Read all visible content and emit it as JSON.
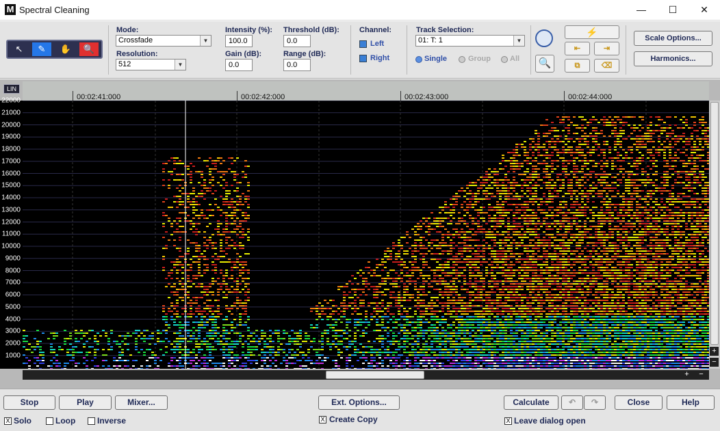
{
  "window": {
    "title": "Spectral Cleaning",
    "app_icon": "M",
    "minimize": "—",
    "maximize": "☐",
    "close": "✕"
  },
  "tools": [
    {
      "icon": "pointer-icon",
      "glyph": "↖"
    },
    {
      "icon": "pencil-icon",
      "glyph": "✎"
    },
    {
      "icon": "hand-icon",
      "glyph": "✋"
    },
    {
      "icon": "zoom-icon",
      "glyph": "🔍"
    }
  ],
  "params": {
    "mode_label": "Mode:",
    "mode_value": "Crossfade",
    "resolution_label": "Resolution:",
    "resolution_value": "512",
    "intensity_label": "Intensity (%):",
    "intensity_value": "100.0",
    "gain_label": "Gain (dB):",
    "gain_value": "0.0",
    "threshold_label": "Threshold (dB):",
    "threshold_value": "0.0",
    "range_label": "Range (dB):",
    "range_value": "0.0"
  },
  "channel": {
    "label": "Channel:",
    "left": "Left",
    "right": "Right"
  },
  "track": {
    "label": "Track Selection:",
    "value": "01: T:  1",
    "single": "Single",
    "group": "Group",
    "all": "All"
  },
  "side_buttons": {
    "scale_options": "Scale Options...",
    "harmonics": "Harmonics..."
  },
  "spectrogram": {
    "scale_toggle": "LIN",
    "time_labels": [
      "00:02:41:000",
      "00:02:42:000",
      "00:02:43:000",
      "00:02:44:000"
    ],
    "freq_labels": [
      "22000",
      "21000",
      "20000",
      "19000",
      "18000",
      "17000",
      "16000",
      "15000",
      "14000",
      "13000",
      "12000",
      "11000",
      "10000",
      "9000",
      "8000",
      "7000",
      "6000",
      "5000",
      "4000",
      "3000",
      "2000",
      "1000"
    ],
    "plus": "+",
    "minus": "−"
  },
  "bottom": {
    "stop": "Stop",
    "play": "Play",
    "mixer": "Mixer...",
    "ext_options": "Ext. Options...",
    "calculate": "Calculate",
    "undo": "↶",
    "redo": "↷",
    "close": "Close",
    "help": "Help",
    "solo": "Solo",
    "loop": "Loop",
    "inverse": "Inverse",
    "create_copy": "Create Copy",
    "leave_open": "Leave dialog open",
    "check_mark": "X"
  }
}
